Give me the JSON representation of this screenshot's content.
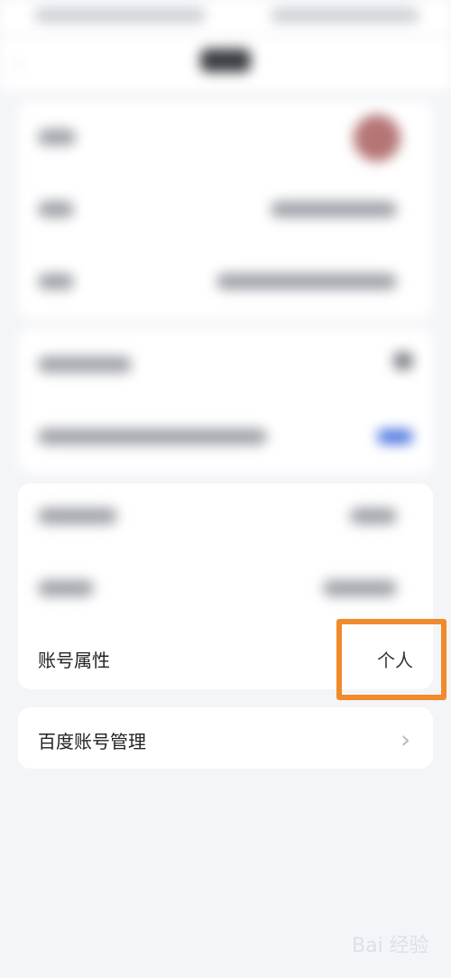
{
  "settings": {
    "account_attribute": {
      "label": "账号属性",
      "value": "个人"
    },
    "baidu_account": {
      "label": "百度账号管理"
    }
  },
  "watermark": {
    "text": "Bai 经验"
  },
  "colors": {
    "highlight": "#f08a2a",
    "background": "#f4f5f8"
  },
  "icons": {
    "back": "back-icon",
    "chevron": "chevron-right-icon",
    "avatar": "avatar"
  }
}
